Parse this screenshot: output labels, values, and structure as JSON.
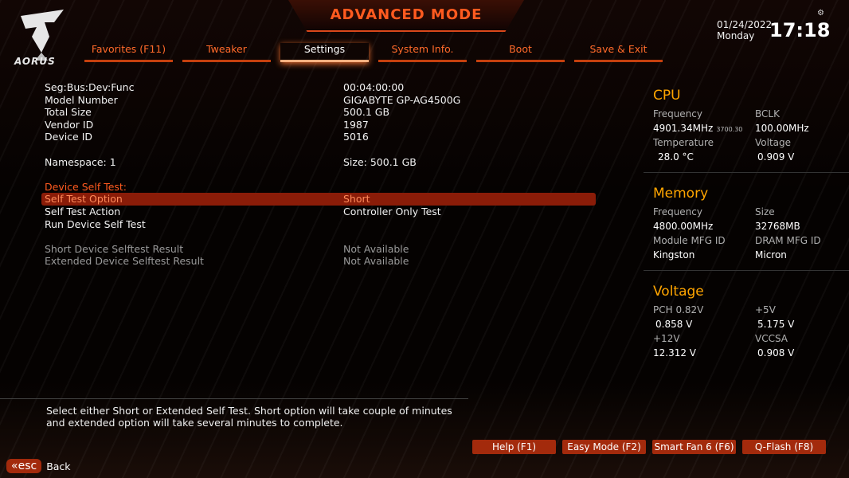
{
  "header": {
    "title": "ADVANCED MODE",
    "logo_text": "AORUS",
    "date": "01/24/2022",
    "day": "Monday",
    "time": "17:18"
  },
  "tabs": [
    {
      "label": "Favorites (F11)"
    },
    {
      "label": "Tweaker"
    },
    {
      "label": "Settings"
    },
    {
      "label": "System Info."
    },
    {
      "label": "Boot"
    },
    {
      "label": "Save & Exit"
    }
  ],
  "active_tab": "Settings",
  "main": {
    "rows": [
      {
        "k": "Seg:Bus:Dev:Func",
        "v": "00:04:00:00"
      },
      {
        "k": "Model Number",
        "v": "GIGABYTE GP-AG4500G"
      },
      {
        "k": "Total Size",
        "v": "500.1 GB"
      },
      {
        "k": "Vendor ID",
        "v": "1987"
      },
      {
        "k": "Device ID",
        "v": "5016"
      },
      {
        "k": "Namespace: 1",
        "v": "Size: 500.1 GB"
      },
      {
        "k": "Device Self Test:",
        "v": ""
      },
      {
        "k": "Self Test Option",
        "v": "Short"
      },
      {
        "k": "Self Test Action",
        "v": "Controller Only Test"
      },
      {
        "k": "Run Device Self Test",
        "v": ""
      },
      {
        "k": "Short Device Selftest Result",
        "v": "Not Available"
      },
      {
        "k": "Extended Device Selftest Result",
        "v": "Not Available"
      }
    ]
  },
  "sidebar": {
    "cpu": {
      "title": "CPU",
      "freq_label": "Frequency",
      "freq_val": "4901.34MHz",
      "freq_small": "3700.30",
      "bclk_label": "BCLK",
      "bclk_val": "100.00MHz",
      "temp_label": "Temperature",
      "temp_val": "28.0 °C",
      "volt_label": "Voltage",
      "volt_val": "0.909 V"
    },
    "memory": {
      "title": "Memory",
      "freq_label": "Frequency",
      "freq_val": "4800.00MHz",
      "size_label": "Size",
      "size_val": "32768MB",
      "mfg_label": "Module MFG ID",
      "mfg_val": "Kingston",
      "dram_label": "DRAM MFG ID",
      "dram_val": "Micron"
    },
    "voltage": {
      "title": "Voltage",
      "pch_label": "PCH 0.82V",
      "pch_val": "0.858 V",
      "v5_label": "+5V",
      "v5_val": "5.175 V",
      "v12_label": "+12V",
      "v12_val": "12.312 V",
      "vccsa_label": "VCCSA",
      "vccsa_val": "0.908 V"
    }
  },
  "help_text": "Select either Short or Extended Self Test. Short option will take couple of minutes and extended option will take several minutes to complete.",
  "footer_buttons": [
    {
      "label": "Help (F1)"
    },
    {
      "label": "Easy Mode (F2)"
    },
    {
      "label": "Smart Fan 6 (F6)"
    },
    {
      "label": "Q-Flash (F8)"
    }
  ],
  "esc": {
    "key": "esc",
    "back": "Back"
  },
  "colors": {
    "accent": "#ff5a1f",
    "selected_row": "#8a1c08",
    "sidebar_title": "#ffa500",
    "button_bg": "#a32a0c"
  }
}
